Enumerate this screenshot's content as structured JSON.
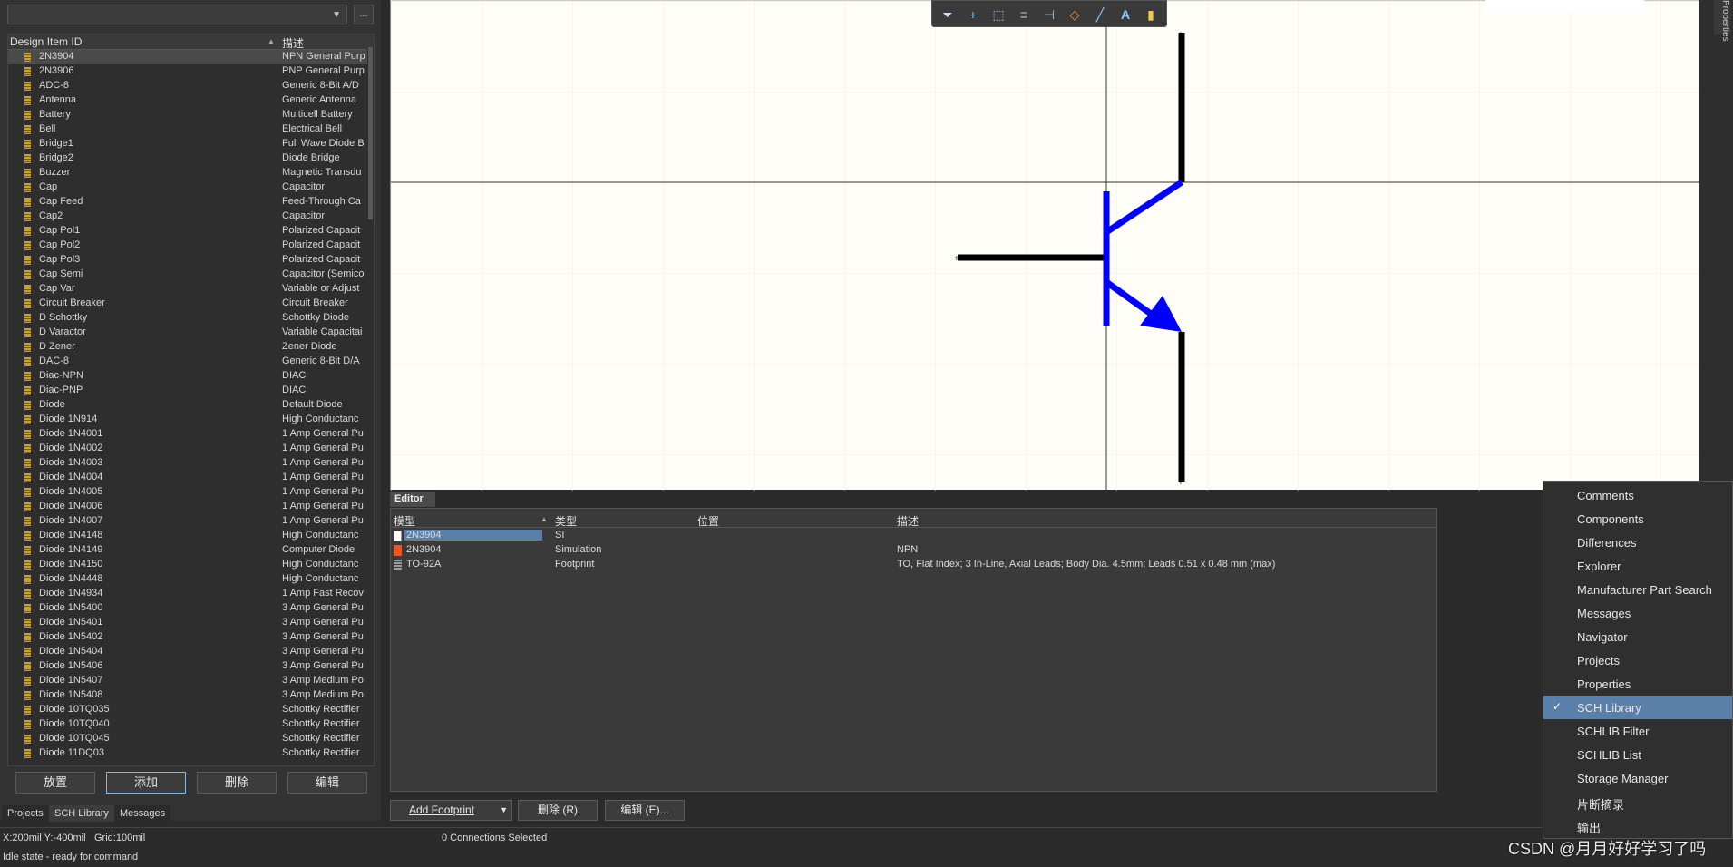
{
  "library_combo": {
    "value": "",
    "browse_label": "..."
  },
  "component_table": {
    "col_id": "Design Item ID",
    "col_desc": "描述",
    "rows": [
      {
        "id": "2N3904",
        "desc": "NPN General Purp",
        "selected": true
      },
      {
        "id": "2N3906",
        "desc": "PNP General Purp"
      },
      {
        "id": "ADC-8",
        "desc": "Generic 8-Bit A/D"
      },
      {
        "id": "Antenna",
        "desc": "Generic Antenna"
      },
      {
        "id": "Battery",
        "desc": "Multicell Battery"
      },
      {
        "id": "Bell",
        "desc": "Electrical Bell"
      },
      {
        "id": "Bridge1",
        "desc": "Full Wave Diode B"
      },
      {
        "id": "Bridge2",
        "desc": "Diode Bridge"
      },
      {
        "id": "Buzzer",
        "desc": "Magnetic Transdu"
      },
      {
        "id": "Cap",
        "desc": "Capacitor"
      },
      {
        "id": "Cap Feed",
        "desc": "Feed-Through Ca"
      },
      {
        "id": "Cap2",
        "desc": "Capacitor"
      },
      {
        "id": "Cap Pol1",
        "desc": "Polarized Capacit"
      },
      {
        "id": "Cap Pol2",
        "desc": "Polarized Capacit"
      },
      {
        "id": "Cap Pol3",
        "desc": "Polarized Capacit"
      },
      {
        "id": "Cap Semi",
        "desc": "Capacitor (Semico"
      },
      {
        "id": "Cap Var",
        "desc": "Variable or Adjust"
      },
      {
        "id": "Circuit Breaker",
        "desc": "Circuit Breaker"
      },
      {
        "id": "D Schottky",
        "desc": "Schottky Diode"
      },
      {
        "id": "D Varactor",
        "desc": "Variable Capacitai"
      },
      {
        "id": "D Zener",
        "desc": "Zener Diode"
      },
      {
        "id": "DAC-8",
        "desc": "Generic 8-Bit D/A"
      },
      {
        "id": "Diac-NPN",
        "desc": "DIAC"
      },
      {
        "id": "Diac-PNP",
        "desc": "DIAC"
      },
      {
        "id": "Diode",
        "desc": "Default Diode"
      },
      {
        "id": "Diode 1N914",
        "desc": "High Conductanc"
      },
      {
        "id": "Diode 1N4001",
        "desc": "1 Amp General Pu"
      },
      {
        "id": "Diode 1N4002",
        "desc": "1 Amp General Pu"
      },
      {
        "id": "Diode 1N4003",
        "desc": "1 Amp General Pu"
      },
      {
        "id": "Diode 1N4004",
        "desc": "1 Amp General Pu"
      },
      {
        "id": "Diode 1N4005",
        "desc": "1 Amp General Pu"
      },
      {
        "id": "Diode 1N4006",
        "desc": "1 Amp General Pu"
      },
      {
        "id": "Diode 1N4007",
        "desc": "1 Amp General Pu"
      },
      {
        "id": "Diode 1N4148",
        "desc": "High Conductanc"
      },
      {
        "id": "Diode 1N4149",
        "desc": "Computer Diode"
      },
      {
        "id": "Diode 1N4150",
        "desc": "High Conductanc"
      },
      {
        "id": "Diode 1N4448",
        "desc": "High Conductanc"
      },
      {
        "id": "Diode 1N4934",
        "desc": "1 Amp Fast Recov"
      },
      {
        "id": "Diode 1N5400",
        "desc": "3 Amp General Pu"
      },
      {
        "id": "Diode 1N5401",
        "desc": "3 Amp General Pu"
      },
      {
        "id": "Diode 1N5402",
        "desc": "3 Amp General Pu"
      },
      {
        "id": "Diode 1N5404",
        "desc": "3 Amp General Pu"
      },
      {
        "id": "Diode 1N5406",
        "desc": "3 Amp General Pu"
      },
      {
        "id": "Diode 1N5407",
        "desc": "3 Amp Medium Po"
      },
      {
        "id": "Diode 1N5408",
        "desc": "3 Amp Medium Po"
      },
      {
        "id": "Diode 10TQ035",
        "desc": "Schottky Rectifier"
      },
      {
        "id": "Diode 10TQ040",
        "desc": "Schottky Rectifier"
      },
      {
        "id": "Diode 10TQ045",
        "desc": "Schottky Rectifier"
      },
      {
        "id": "Diode 11DQ03",
        "desc": "Schottky Rectifier"
      }
    ]
  },
  "left_buttons": {
    "place": "放置",
    "add": "添加",
    "delete": "删除",
    "edit": "编辑"
  },
  "panel_tabs": [
    "Projects",
    "SCH Library",
    "Messages"
  ],
  "canvas_toolbar_icons": [
    "filter-icon",
    "crosshair-icon",
    "select-rect-icon",
    "align-icon",
    "pin-icon",
    "eraser-icon",
    "line-icon",
    "text-icon",
    "component-icon"
  ],
  "props_tab_label": "Properties",
  "editor": {
    "tab_label": "Editor",
    "col_model": "模型",
    "col_type": "类型",
    "col_location": "位置",
    "col_desc": "描述",
    "rows": [
      {
        "model": "2N3904",
        "type": "SI",
        "location": "",
        "desc": "",
        "selected": true,
        "icon": "si-model-icon"
      },
      {
        "model": "2N3904",
        "type": "Simulation",
        "location": "",
        "desc": "NPN",
        "icon": "simulation-model-icon"
      },
      {
        "model": "TO-92A",
        "type": "Footprint",
        "location": "",
        "desc": "TO, Flat Index; 3 In-Line, Axial Leads; Body Dia. 4.5mm; Leads 0.51 x 0.48 mm (max)",
        "icon": "footprint-model-icon"
      }
    ],
    "add_footprint": "Add Footprint",
    "delete_label": "删除 (R)",
    "edit_label": "编辑 (E)..."
  },
  "status": {
    "coords": "X:200mil Y:-400mil",
    "grid": "Grid:100mil",
    "connections": "0 Connections Selected",
    "state": "Idle state - ready for command"
  },
  "panels_menu": {
    "items": [
      {
        "label": "Comments"
      },
      {
        "label": "Components"
      },
      {
        "label": "Differences"
      },
      {
        "label": "Explorer"
      },
      {
        "label": "Manufacturer Part Search"
      },
      {
        "label": "Messages"
      },
      {
        "label": "Navigator"
      },
      {
        "label": "Projects"
      },
      {
        "label": "Properties"
      },
      {
        "label": "SCH Library",
        "checked": true
      },
      {
        "label": "SCHLIB Filter"
      },
      {
        "label": "SCHLIB List"
      },
      {
        "label": "Storage Manager"
      },
      {
        "label": "片断摘录"
      },
      {
        "label": "输出"
      }
    ]
  },
  "watermark": "CSDN @月月好好学习了吗",
  "colors": {
    "symbol_blue": "#0000ff",
    "pin_black": "#000000",
    "selection": "#5a7fa8",
    "canvas_bg": "#fffdf7"
  }
}
